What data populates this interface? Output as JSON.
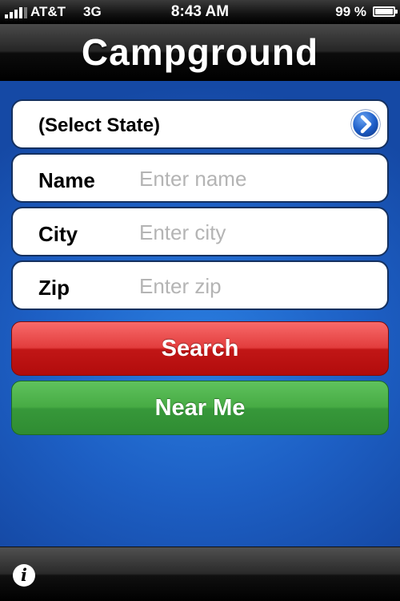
{
  "status_bar": {
    "carrier": "AT&T",
    "network": "3G",
    "time": "8:43 AM",
    "battery_percent_label": "99 %",
    "battery_level": 0.99
  },
  "header": {
    "title": "Campground"
  },
  "form": {
    "state_select": {
      "label": "(Select State)",
      "icon": "chevron-right-circle-icon"
    },
    "name": {
      "label": "Name",
      "placeholder": "Enter name",
      "value": ""
    },
    "city": {
      "label": "City",
      "placeholder": "Enter city",
      "value": ""
    },
    "zip": {
      "label": "Zip",
      "placeholder": "Enter zip",
      "value": ""
    }
  },
  "buttons": {
    "search": "Search",
    "near_me": "Near Me"
  },
  "toolbar": {
    "info_icon": "info-icon",
    "info_glyph": "i"
  },
  "colors": {
    "background_blue": "#1d5fc4",
    "search_red": "#c11616",
    "near_me_green": "#3a9b3a",
    "field_border": "#14305f",
    "disclosure_blue": "#1e5fc9"
  }
}
